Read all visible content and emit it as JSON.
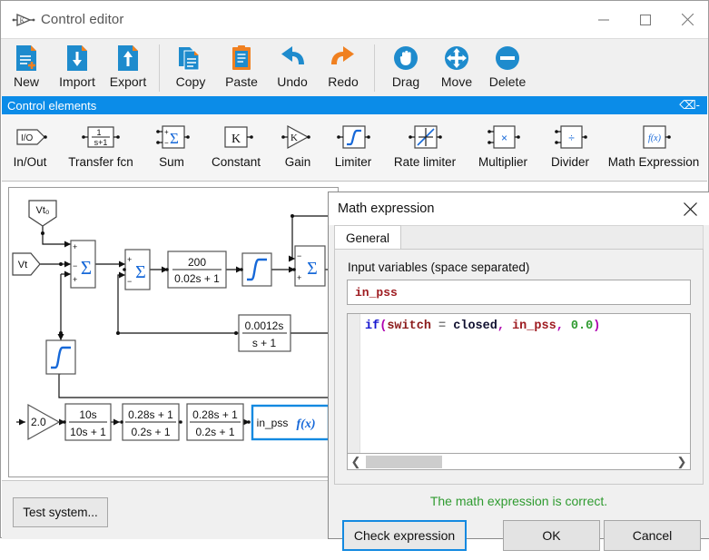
{
  "window": {
    "title": "Control editor",
    "app_icon": "gain-block-icon",
    "controls": {
      "minimize": "minimize-icon",
      "maximize": "maximize-icon",
      "close": "close-icon"
    }
  },
  "toolbar": {
    "items": [
      {
        "label": "New",
        "icon": "new-file-icon"
      },
      {
        "label": "Import",
        "icon": "import-file-icon"
      },
      {
        "label": "Export",
        "icon": "export-file-icon"
      },
      {
        "label": "Copy",
        "icon": "copy-icon"
      },
      {
        "label": "Paste",
        "icon": "paste-icon"
      },
      {
        "label": "Undo",
        "icon": "undo-arrow-icon"
      },
      {
        "label": "Redo",
        "icon": "redo-arrow-icon"
      },
      {
        "label": "Drag",
        "icon": "hand-drag-icon"
      },
      {
        "label": "Move",
        "icon": "move-arrows-icon"
      },
      {
        "label": "Delete",
        "icon": "delete-minus-icon"
      }
    ]
  },
  "palette": {
    "header": "Control elements",
    "pin_icon": "pin-icon",
    "items": [
      {
        "label": "In/Out",
        "icon": "in-out-port-icon"
      },
      {
        "label": "Transfer fcn",
        "icon": "transfer-function-icon",
        "num": "1",
        "den": "s+1"
      },
      {
        "label": "Sum",
        "icon": "sum-block-icon"
      },
      {
        "label": "Constant",
        "icon": "constant-block-icon",
        "symbol": "K"
      },
      {
        "label": "Gain",
        "icon": "gain-triangle-icon",
        "symbol": "K"
      },
      {
        "label": "Limiter",
        "icon": "limiter-block-icon"
      },
      {
        "label": "Rate limiter",
        "icon": "rate-limiter-icon"
      },
      {
        "label": "Multiplier",
        "icon": "multiplier-block-icon",
        "symbol": "×"
      },
      {
        "label": "Divider",
        "icon": "divider-block-icon",
        "symbol": "÷"
      },
      {
        "label": "Math Expression",
        "icon": "math-expression-icon",
        "symbol": "f(x)"
      }
    ]
  },
  "diagram": {
    "blocks": {
      "vt0_port": "Vt₀",
      "vt_port": "Vt",
      "sum1": "Σ",
      "sum2": "Σ",
      "sum3": "Σ",
      "tf_main_num": "200",
      "tf_main_den": "0.02s + 1",
      "tf_feedback_num": "0.0012s",
      "tf_feedback_den": "s + 1",
      "limiter1": "limiter-curve-icon",
      "limiter2": "limiter-curve-icon",
      "limiter3": "limiter-curve-icon",
      "gain": "2.0",
      "washout_num": "10s",
      "washout_den": "10s + 1",
      "lead_lag1_num": "0.28s + 1",
      "lead_lag1_den": "0.2s + 1",
      "lead_lag2_num": "0.28s + 1",
      "lead_lag2_den": "0.2s + 1",
      "math_block_label": "in_pss",
      "math_block_symbol": "f(x)"
    },
    "sum_signs": {
      "plus": "+",
      "minus": "−"
    }
  },
  "bottom": {
    "test_system_label": "Test system..."
  },
  "dialog": {
    "title": "Math expression",
    "close_icon": "close-icon",
    "tab": "General",
    "input_vars_label": "Input variables (space separated)",
    "input_vars_value": "in_pss",
    "expression": {
      "tokens": [
        {
          "text": "if",
          "color": "#1414cf"
        },
        {
          "text": "(",
          "color": "#b000b0"
        },
        {
          "text": "switch",
          "color": "#8b1a1a"
        },
        {
          "text": " ",
          "color": "#000000"
        },
        {
          "text": "=",
          "color": "#808080"
        },
        {
          "text": " ",
          "color": "#000000"
        },
        {
          "text": "closed",
          "color": "#101030"
        },
        {
          "text": ",",
          "color": "#b000b0"
        },
        {
          "text": " ",
          "color": "#000000"
        },
        {
          "text": "in_pss",
          "color": "#9e1b20"
        },
        {
          "text": ",",
          "color": "#b000b0"
        },
        {
          "text": " ",
          "color": "#000000"
        },
        {
          "text": "0.0",
          "color": "#2f9b30"
        },
        {
          "text": ")",
          "color": "#b000b0"
        }
      ],
      "plain": "if(switch = closed, in_pss, 0.0)"
    },
    "scroll_left_icon": "chevron-left-icon",
    "scroll_right_icon": "chevron-right-icon",
    "status_message": "The math expression is correct.",
    "status_color": "#2f9b30",
    "buttons": {
      "check": "Check expression",
      "ok": "OK",
      "cancel": "Cancel"
    }
  },
  "colors": {
    "accent_blue": "#0b8ce8",
    "icon_blue": "#1e8bcd",
    "icon_orange": "#f08020",
    "focus_blue": "#1389e0",
    "toolbar_bg": "#f0f0f0"
  }
}
